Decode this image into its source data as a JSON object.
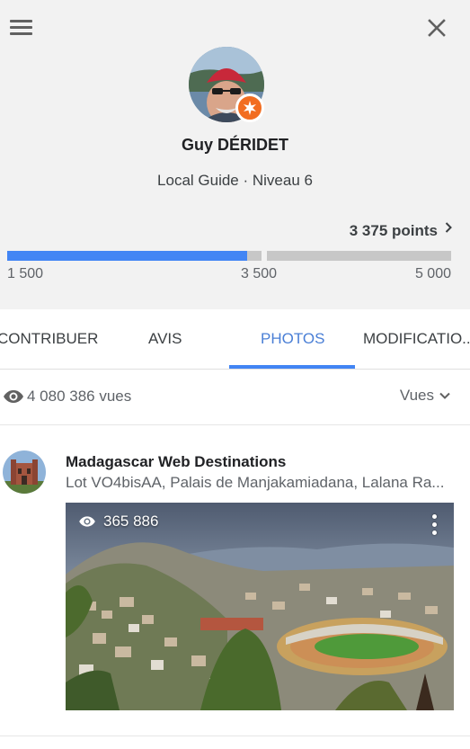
{
  "header": {
    "menu_icon": "hamburger-menu-icon",
    "close_icon": "close-icon"
  },
  "profile": {
    "name": "Guy DÉRIDET",
    "level_label": "Local Guide · Niveau 6",
    "badge_icon": "local-guide-star-icon",
    "badge_color": "#f26d21",
    "points": "3 375 points",
    "progress": {
      "current": 3375,
      "min": 1500,
      "max": 5000,
      "fill_fraction": 0.54,
      "ticks": [
        "1 500",
        "3 500",
        "5 000"
      ]
    }
  },
  "tabs": [
    {
      "label": "CONTRIBUER",
      "active": false
    },
    {
      "label": "AVIS",
      "active": false
    },
    {
      "label": "PHOTOS",
      "active": true
    },
    {
      "label": "MODIFICATIO..",
      "active": false
    }
  ],
  "accent_color": "#4285f4",
  "views": {
    "icon": "eye-icon",
    "total": "4 080 386 vues",
    "sort_label": "Vues"
  },
  "items": [
    {
      "title": "Madagascar Web Destinations",
      "address": "Lot VO4bisAA, Palais de Manjakamiadana, Lalana Ra...",
      "photo_views": "365 886"
    }
  ]
}
